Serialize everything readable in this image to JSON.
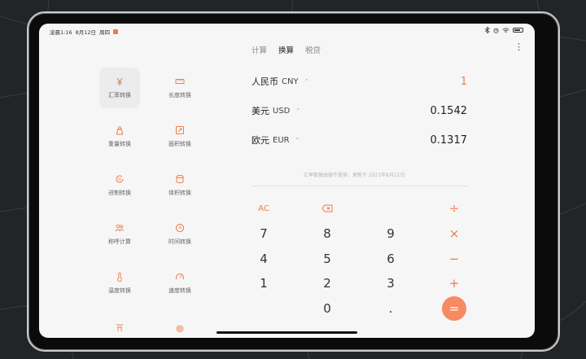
{
  "status": {
    "time": "凌晨1:16",
    "date": "8月12日",
    "weekday": "周四"
  },
  "tabs": [
    {
      "label": "计算",
      "active": false
    },
    {
      "label": "换算",
      "active": true
    },
    {
      "label": "税贷",
      "active": false
    }
  ],
  "sidebar": {
    "items": [
      {
        "label": "汇率转换",
        "icon": "yuan-icon",
        "active": true
      },
      {
        "label": "长度转换",
        "icon": "ruler-icon",
        "active": false
      },
      {
        "label": "重量转换",
        "icon": "weight-icon",
        "active": false
      },
      {
        "label": "面积转换",
        "icon": "area-icon",
        "active": false
      },
      {
        "label": "进制转换",
        "icon": "base-icon",
        "active": false
      },
      {
        "label": "体积转换",
        "icon": "volume-icon",
        "active": false
      },
      {
        "label": "称呼计算",
        "icon": "people-icon",
        "active": false
      },
      {
        "label": "时间转换",
        "icon": "clock-icon",
        "active": false
      },
      {
        "label": "温度转换",
        "icon": "thermometer-icon",
        "active": false
      },
      {
        "label": "速度转换",
        "icon": "speed-icon",
        "active": false
      }
    ]
  },
  "currencies": [
    {
      "name": "人民币",
      "code": "CNY",
      "value": "1",
      "active": true
    },
    {
      "name": "美元",
      "code": "USD",
      "value": "0.1542",
      "active": false
    },
    {
      "name": "欧元",
      "code": "EUR",
      "value": "0.1317",
      "active": false
    }
  ],
  "note": "汇率数据由银牛提供，更新于 2021年8月11日",
  "keypad": {
    "ac": "AC",
    "digits": [
      "7",
      "8",
      "9",
      "4",
      "5",
      "6",
      "1",
      "2",
      "3",
      "0",
      "."
    ],
    "divide": "÷",
    "multiply": "×",
    "minus": "−",
    "plus": "+",
    "equals": "="
  },
  "colors": {
    "accent": "#f07a45",
    "equals_bg": "#f68a62",
    "screen_bg": "#f6f6f7"
  }
}
